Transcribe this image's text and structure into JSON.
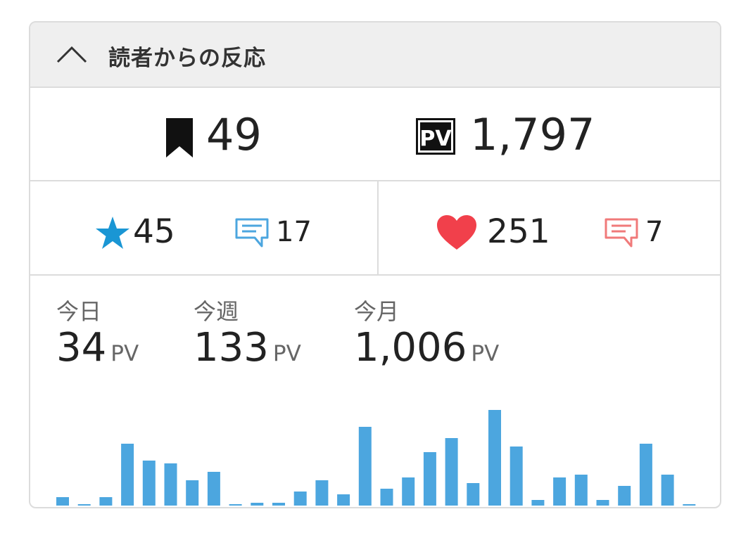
{
  "header": {
    "title": "読者からの反応"
  },
  "counts": {
    "bookmarks": "49",
    "pv_badge": "PV",
    "pageviews": "1,797"
  },
  "reactions": {
    "stars": "45",
    "blue_comments": "17",
    "hearts": "251",
    "red_comments": "7"
  },
  "stats": {
    "today": {
      "label": "今日",
      "value": "34",
      "unit": "PV"
    },
    "week": {
      "label": "今週",
      "value": "133",
      "unit": "PV"
    },
    "month": {
      "label": "今月",
      "value": "1,006",
      "unit": "PV"
    }
  },
  "colors": {
    "bar": "#4ca6df",
    "star": "#1a96d4",
    "heart": "#f1404b",
    "comment_blue": "#4ca6df",
    "comment_red": "#f07a7a"
  },
  "chart_data": {
    "type": "bar",
    "categories": [
      "1",
      "2",
      "3",
      "4",
      "5",
      "6",
      "7",
      "8",
      "9",
      "10",
      "11",
      "12",
      "13",
      "14",
      "15",
      "16",
      "17",
      "18",
      "19",
      "20",
      "21",
      "22",
      "23",
      "24",
      "25",
      "26",
      "27",
      "28",
      "29",
      "30"
    ],
    "values": [
      3,
      0,
      3,
      22,
      16,
      15,
      9,
      12,
      0,
      1,
      1,
      5,
      9,
      4,
      28,
      6,
      10,
      19,
      24,
      8,
      34,
      21,
      2,
      10,
      11,
      2,
      7,
      22,
      11,
      0
    ],
    "ylim": [
      0,
      34
    ]
  }
}
